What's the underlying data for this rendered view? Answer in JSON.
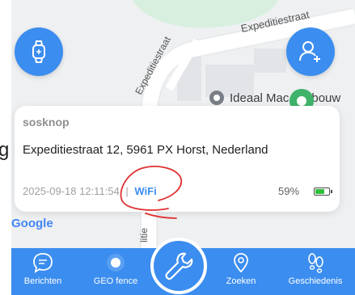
{
  "map": {
    "street_top": "Expeditiestraat",
    "street_mid": "Expeditiestraat",
    "street_bottom": "litie",
    "poi_label": "Ideaal Mac",
    "poi_label_tail": "bouw",
    "attribution": "Google",
    "edge_letter": "g"
  },
  "fab": {
    "watch_icon": "watch-icon",
    "add_user_icon": "add-user-icon"
  },
  "card": {
    "title": "sosknop",
    "address": "Expeditiestraat 12, 5961 PX Horst, Nederland",
    "timestamp": "2025-09-18 12:11:54",
    "separator": "|",
    "source": "WiFi",
    "battery_percent": "59%",
    "battery_level": 0.59
  },
  "nav": {
    "berichten": "Berichten",
    "geofence": "GEO fence",
    "zoeken": "Zoeken",
    "geschiedenis": "Geschiedenis",
    "center_icon": "wrench-icon"
  },
  "colors": {
    "accent": "#3b8def",
    "pin": "#3fb36a",
    "battery": "#2fbf3c",
    "annotation": "#e03030"
  }
}
